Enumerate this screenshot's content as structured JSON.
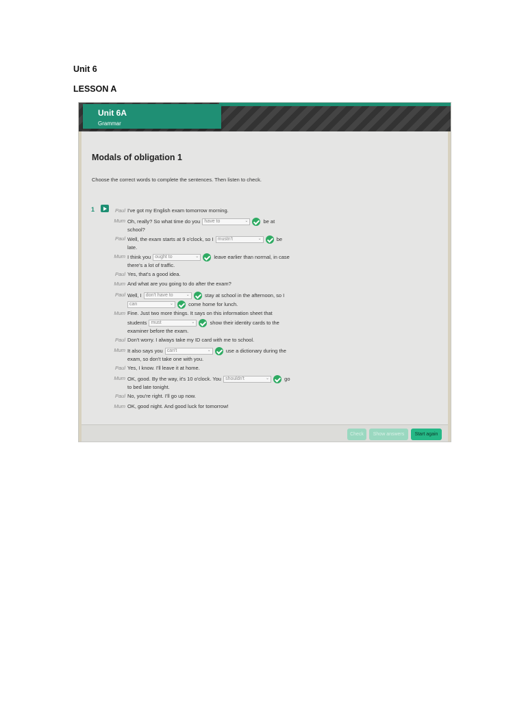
{
  "doc": {
    "unit_heading": "Unit 6",
    "lesson_heading": "LESSON A"
  },
  "header": {
    "unit_tab": "Unit 6A",
    "section": "Grammar"
  },
  "exercise": {
    "title": "Modals of obligation 1",
    "instructions": "Choose the correct words to complete the sentences. Then listen to check.",
    "number": "1"
  },
  "dialogue": {
    "l1": {
      "speaker": "Paul",
      "t1": "I've got my English exam tomorrow morning."
    },
    "l2": {
      "speaker": "Mum",
      "t1": "Oh, really? So what time do you",
      "dd1": "have to",
      "t2": "be at"
    },
    "l3": {
      "t1": "school?"
    },
    "l4": {
      "speaker": "Paul",
      "t1": "Well, the exam starts at 9 o'clock, so I",
      "dd1": "mustn't",
      "t2": "be"
    },
    "l5": {
      "t1": "late."
    },
    "l6": {
      "speaker": "Mum",
      "t1": "I think you",
      "dd1": "ought to",
      "t2": "leave earlier than normal, in case"
    },
    "l7": {
      "t1": "there's a lot of traffic."
    },
    "l8": {
      "speaker": "Paul",
      "t1": "Yes, that's a good idea."
    },
    "l9": {
      "speaker": "Mum",
      "t1": "And what are you going to do after the exam?"
    },
    "l10": {
      "speaker": "Paul",
      "t1": "Well, I",
      "dd1": "don't have to",
      "t2": "stay at school in the afternoon, so I"
    },
    "l11": {
      "dd1": "can",
      "t1": "come home for lunch."
    },
    "l12": {
      "speaker": "Mum",
      "t1": "Fine. Just two more things. It says on this information sheet that"
    },
    "l13": {
      "t1": "students",
      "dd1": "must",
      "t2": "show their identity cards to the"
    },
    "l14": {
      "t1": "examiner before the exam."
    },
    "l15": {
      "speaker": "Paul",
      "t1": "Don't worry. I always take my ID card with me to school."
    },
    "l16": {
      "speaker": "Mum",
      "t1": "It also says you",
      "dd1": "can't",
      "t2": "use a dictionary during the"
    },
    "l17": {
      "t1": "exam, so don't take one with you."
    },
    "l18": {
      "speaker": "Paul",
      "t1": "Yes, I know. I'll leave it at home."
    },
    "l19": {
      "speaker": "Mum",
      "t1": "OK, good. By the way, it's 10 o'clock. You",
      "dd1": "shouldn't",
      "t2": "go"
    },
    "l20": {
      "t1": "to bed late tonight."
    },
    "l21": {
      "speaker": "Paul",
      "t1": "No, you're right. I'll go up now."
    },
    "l22": {
      "speaker": "Mum",
      "t1": "OK, good night. And good luck for tomorrow!"
    }
  },
  "footer": {
    "check": "Check",
    "show_answers": "Show answers",
    "start_again": "Start again"
  },
  "colors": {
    "brand_teal": "#1f8f74",
    "check_green": "#2eaa62",
    "button_teal": "#25b886"
  }
}
